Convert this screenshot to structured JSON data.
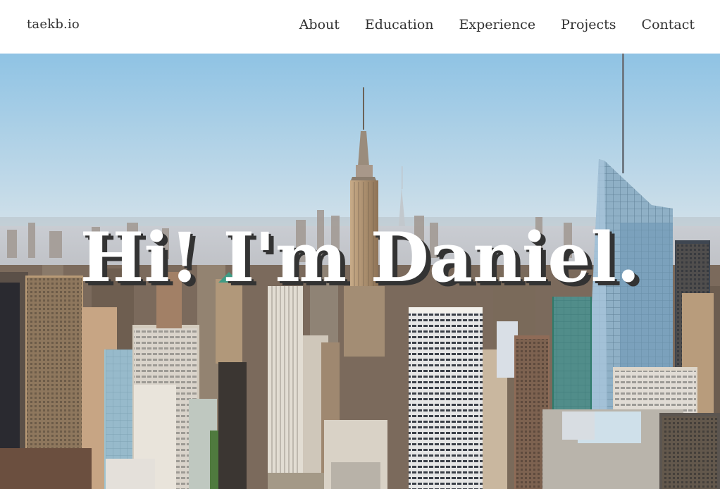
{
  "navbar": {
    "brand": "taekb.io",
    "links": [
      "About",
      "Education",
      "Experience",
      "Projects",
      "Contact"
    ]
  },
  "hero": {
    "title": "Hi! I'm Daniel.",
    "background": "city-skyline-image"
  },
  "colors": {
    "nav_text": "#333333",
    "title_text": "#ffffff",
    "title_shadow": "#333333",
    "sky_top": "#9ec9e6",
    "sky_horizon": "#f7e8d6"
  }
}
